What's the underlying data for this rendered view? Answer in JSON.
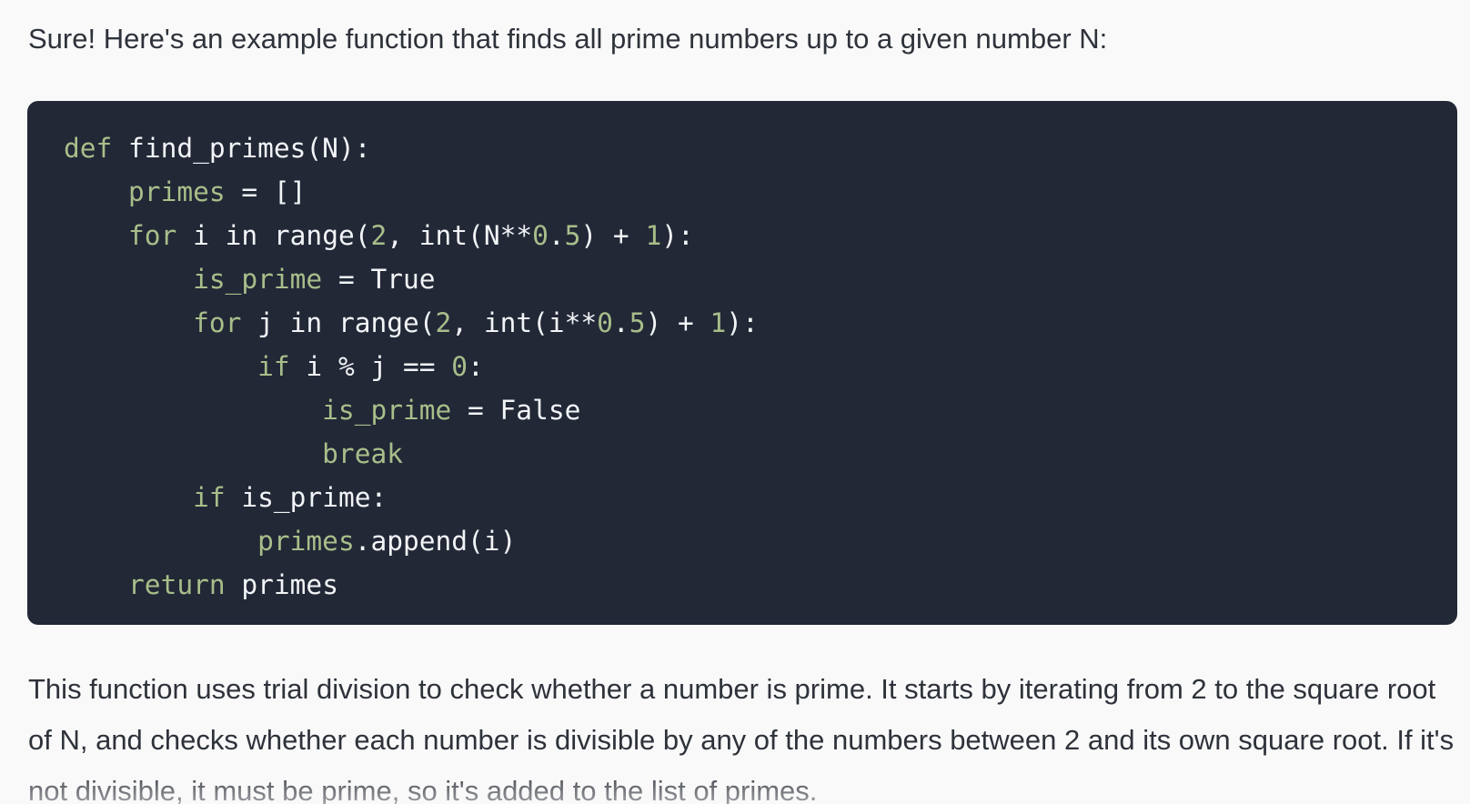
{
  "message": {
    "intro": "Sure! Here's an example function that finds all prime numbers up to a given number N:",
    "code": {
      "language": "python",
      "lines": [
        [
          {
            "t": "def",
            "c": "kw"
          },
          {
            "t": " find_primes(N):",
            "c": "plain"
          }
        ],
        [
          {
            "t": "    ",
            "c": "plain"
          },
          {
            "t": "primes",
            "c": "var"
          },
          {
            "t": " = []",
            "c": "plain"
          }
        ],
        [
          {
            "t": "    ",
            "c": "plain"
          },
          {
            "t": "for",
            "c": "kw"
          },
          {
            "t": " i in range(",
            "c": "plain"
          },
          {
            "t": "2",
            "c": "num"
          },
          {
            "t": ", int(N**",
            "c": "plain"
          },
          {
            "t": "0",
            "c": "num"
          },
          {
            "t": ".",
            "c": "plain"
          },
          {
            "t": "5",
            "c": "num"
          },
          {
            "t": ") + ",
            "c": "plain"
          },
          {
            "t": "1",
            "c": "num"
          },
          {
            "t": "):",
            "c": "plain"
          }
        ],
        [
          {
            "t": "        ",
            "c": "plain"
          },
          {
            "t": "is_prime",
            "c": "var"
          },
          {
            "t": " = True",
            "c": "plain"
          }
        ],
        [
          {
            "t": "        ",
            "c": "plain"
          },
          {
            "t": "for",
            "c": "kw"
          },
          {
            "t": " j in range(",
            "c": "plain"
          },
          {
            "t": "2",
            "c": "num"
          },
          {
            "t": ", int(i**",
            "c": "plain"
          },
          {
            "t": "0",
            "c": "num"
          },
          {
            "t": ".",
            "c": "plain"
          },
          {
            "t": "5",
            "c": "num"
          },
          {
            "t": ") + ",
            "c": "plain"
          },
          {
            "t": "1",
            "c": "num"
          },
          {
            "t": "):",
            "c": "plain"
          }
        ],
        [
          {
            "t": "            ",
            "c": "plain"
          },
          {
            "t": "if",
            "c": "kw"
          },
          {
            "t": " i % j == ",
            "c": "plain"
          },
          {
            "t": "0",
            "c": "num"
          },
          {
            "t": ":",
            "c": "plain"
          }
        ],
        [
          {
            "t": "                ",
            "c": "plain"
          },
          {
            "t": "is_prime",
            "c": "var"
          },
          {
            "t": " = False",
            "c": "plain"
          }
        ],
        [
          {
            "t": "                ",
            "c": "plain"
          },
          {
            "t": "break",
            "c": "kw"
          }
        ],
        [
          {
            "t": "        ",
            "c": "plain"
          },
          {
            "t": "if",
            "c": "kw"
          },
          {
            "t": " is_prime:",
            "c": "plain"
          }
        ],
        [
          {
            "t": "            ",
            "c": "plain"
          },
          {
            "t": "primes",
            "c": "var"
          },
          {
            "t": ".append(i)",
            "c": "plain"
          }
        ],
        [
          {
            "t": "    ",
            "c": "plain"
          },
          {
            "t": "return",
            "c": "kw"
          },
          {
            "t": " primes",
            "c": "plain"
          }
        ]
      ]
    },
    "explanation": "This function uses trial division to check whether a number is prime. It starts by iterating from 2 to the square root of N, and checks whether each number is divisible by any of the numbers between 2 and its own square root. If it's not divisible, it must be prime, so it's added to the list of primes."
  },
  "colors": {
    "page_background": "#f9f9fa",
    "code_background": "#222836",
    "code_text": "#f2f4f7",
    "code_keyword": "#a8be8a",
    "body_text": "#2e323a"
  }
}
